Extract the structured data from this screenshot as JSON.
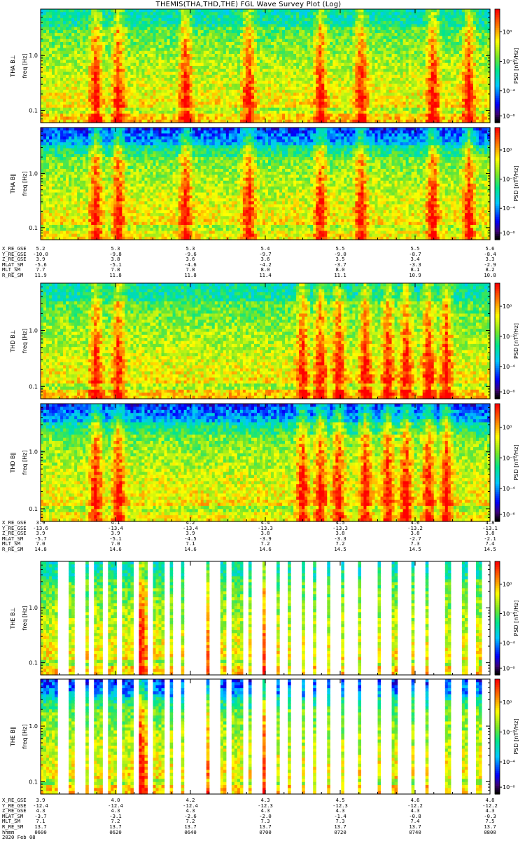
{
  "title": "THEMIS(THA,THD,THE) FGL Wave Survey Plot (Log)",
  "chart_data": [
    {
      "type": "heatmap",
      "id": "tha_bl",
      "ylabel_1": "THA B⊥",
      "ylabel_2": "freq [Hz]",
      "zlabel": "PSD [nT²/Hz]",
      "yticks": [
        "1.0",
        "0.1"
      ],
      "zticks": [
        "10⁰",
        "10⁻²",
        "10⁻⁴",
        "10⁻⁶"
      ],
      "yscale": "log",
      "bursts": [
        0.12,
        0.17,
        0.32,
        0.46,
        0.62,
        0.71,
        0.87,
        0.95
      ]
    },
    {
      "type": "heatmap",
      "id": "tha_bpar",
      "ylabel_1": "THA B∥",
      "ylabel_2": "freq [Hz]",
      "zlabel": "PSD [nT²/Hz]",
      "yticks": [
        "1.0",
        "0.1"
      ],
      "zticks": [
        "10⁰",
        "10⁻²",
        "10⁻⁴",
        "10⁻⁶"
      ],
      "yscale": "log",
      "bursts": [
        0.12,
        0.17,
        0.32,
        0.46,
        0.62,
        0.71,
        0.87,
        0.95
      ]
    },
    {
      "type": "heatmap",
      "id": "thd_bl",
      "ylabel_1": "THD B⊥",
      "ylabel_2": "freq [Hz]",
      "zlabel": "PSD [nT²/Hz]",
      "yticks": [
        "1.0",
        "0.1"
      ],
      "zticks": [
        "10⁰",
        "10⁻²",
        "10⁻⁴",
        "10⁻⁶"
      ],
      "yscale": "log",
      "bursts": [
        0.12,
        0.17,
        0.58,
        0.62,
        0.66,
        0.72,
        0.77,
        0.81,
        0.86,
        0.9
      ]
    },
    {
      "type": "heatmap",
      "id": "thd_bpar",
      "ylabel_1": "THD B∥",
      "ylabel_2": "freq [Hz]",
      "zlabel": "PSD [nT²/Hz]",
      "yticks": [
        "1.0",
        "0.1"
      ],
      "zticks": [
        "10⁰",
        "10⁻²",
        "10⁻⁴",
        "10⁻⁶"
      ],
      "yscale": "log",
      "bursts": [
        0.12,
        0.17,
        0.58,
        0.62,
        0.66,
        0.72,
        0.77,
        0.81,
        0.86,
        0.9
      ]
    },
    {
      "type": "heatmap",
      "id": "the_bl",
      "ylabel_1": "THE B⊥",
      "ylabel_2": "freq [Hz]",
      "zlabel": "PSD [nT²/Hz]",
      "yticks": [
        "1.0",
        "0.1"
      ],
      "zticks": [
        "10⁰",
        "10⁻²",
        "10⁻⁴",
        "10⁻⁶"
      ],
      "yscale": "log",
      "bursts": [
        0.22,
        0.38,
        0.5
      ]
    },
    {
      "type": "heatmap",
      "id": "the_bpar",
      "ylabel_1": "THE B∥",
      "ylabel_2": "freq [Hz]",
      "zlabel": "PSD [nT²/Hz]",
      "yticks": [
        "1.0",
        "0.1"
      ],
      "zticks": [
        "10⁰",
        "10⁻²",
        "10⁻⁴",
        "10⁻⁶"
      ],
      "yscale": "log",
      "bursts": [
        0.22,
        0.38,
        0.5
      ]
    }
  ],
  "ephemeris": [
    {
      "labels": [
        "X_RE_GSE",
        "Y_RE_GSE",
        "Z_RE_GSE",
        "MLAT_SM",
        "MLT_SM",
        "R_RE_SM"
      ],
      "columns": [
        [
          "5.2",
          "-10.0",
          "3.9",
          "-5.6",
          "7.7",
          "11.9"
        ],
        [
          "5.3",
          "-9.8",
          "3.8",
          "-5.1",
          "7.8",
          "11.8"
        ],
        [
          "5.3",
          "-9.6",
          "3.6",
          "-4.6",
          "7.8",
          "11.8"
        ],
        [
          "5.4",
          "-9.7",
          "3.6",
          "-4.2",
          "8.0",
          "11.4"
        ],
        [
          "5.5",
          "-9.0",
          "3.5",
          "-3.7",
          "8.0",
          "11.1"
        ],
        [
          "5.5",
          "-8.7",
          "3.4",
          "-3.3",
          "8.1",
          "10.9"
        ],
        [
          "5.6",
          "-8.4",
          "3.3",
          "-2.9",
          "8.2",
          "10.8"
        ]
      ]
    },
    {
      "labels": [
        "X_RE_GSE",
        "Y_RE_GSE",
        "Z_RE_GSE",
        "MLAT_SM",
        "MLT_SM",
        "R_RE_SM"
      ],
      "columns": [
        [
          "3.9",
          "-13.6",
          "3.9",
          "-5.7",
          "7.0",
          "14.8"
        ],
        [
          "4.1",
          "-13.4",
          "3.9",
          "-5.1",
          "7.0",
          "14.6"
        ],
        [
          "4.2",
          "-13.4",
          "3.9",
          "-4.5",
          "7.1",
          "14.6"
        ],
        [
          "4.4",
          "-13.3",
          "3.8",
          "-3.9",
          "7.2",
          "14.6"
        ],
        [
          "4.5",
          "-13.3",
          "3.8",
          "-3.3",
          "7.2",
          "14.5"
        ],
        [
          "4.6",
          "-13.2",
          "3.8",
          "-2.7",
          "7.3",
          "14.5"
        ],
        [
          "4.8",
          "-13.1",
          "3.8",
          "-2.1",
          "7.4",
          "14.5"
        ]
      ]
    },
    {
      "labels": [
        "X_RE_GSE",
        "Y_RE_GSE",
        "Z_RE_GSE",
        "MLAT_SM",
        "MLT_SM",
        "R_RE_SM",
        "hhmm",
        "2020 Feb 08"
      ],
      "columns": [
        [
          "3.9",
          "-12.4",
          "4.3",
          "-3.7",
          "7.1",
          "13.7",
          "0600"
        ],
        [
          "4.0",
          "-12.4",
          "4.3",
          "-3.1",
          "7.2",
          "13.7",
          "0620"
        ],
        [
          "4.2",
          "-12.4",
          "4.3",
          "-2.6",
          "7.2",
          "13.7",
          "0640"
        ],
        [
          "4.3",
          "-12.3",
          "4.3",
          "-2.0",
          "7.3",
          "13.7",
          "0700"
        ],
        [
          "4.5",
          "-12.3",
          "4.3",
          "-1.4",
          "7.3",
          "13.7",
          "0720"
        ],
        [
          "4.6",
          "-12.2",
          "4.3",
          "-0.8",
          "7.4",
          "13.7",
          "0740"
        ],
        [
          "4.8",
          "-12.2",
          "4.3",
          "-0.3",
          "7.5",
          "13.7",
          "0800"
        ]
      ]
    }
  ]
}
